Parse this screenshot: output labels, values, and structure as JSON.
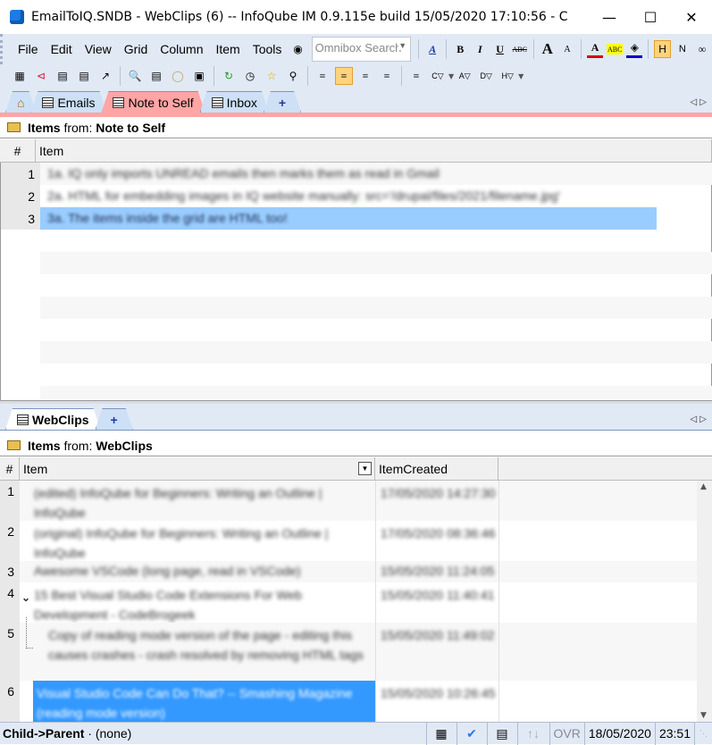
{
  "window": {
    "title": "EmailToIQ.SNDB - WebClips (6) -- InfoQube IM 0.9.115e  build 15/05/2020 17:10:56 - C..."
  },
  "menu": [
    "File",
    "Edit",
    "View",
    "Grid",
    "Column",
    "Item",
    "Tools"
  ],
  "omnibox": {
    "placeholder": "Omnibox Search"
  },
  "format_toolbar": {
    "bold": "B",
    "italic": "I",
    "underline": "U",
    "strike": "ABC",
    "grow": "A",
    "shrink": "A",
    "fontcolor": "A",
    "highlight": "ABC",
    "h": "H",
    "n": "N"
  },
  "filter_toolbar": {
    "c": "C",
    "a": "A",
    "d": "D",
    "h": "H"
  },
  "top_tabs": [
    {
      "label": ""
    },
    {
      "label": "Emails"
    },
    {
      "label": "Note to Self",
      "active": true
    },
    {
      "label": "Inbox"
    },
    {
      "label": "+"
    }
  ],
  "top_pane": {
    "items_label": "Items",
    "from_label": "from:",
    "source": "Note to Self",
    "columns": [
      "#",
      "Item"
    ],
    "rows": [
      {
        "n": "1",
        "item": "1a. IQ only imports UNREAD emails then marks them as read in Gmail"
      },
      {
        "n": "2",
        "item": "2a. HTML for embedding images in IQ website manually: src='/drupal/files/2021/filename.jpg'"
      },
      {
        "n": "3",
        "item": "3a. The items inside the grid are HTML too!",
        "selected": true
      }
    ]
  },
  "bottom_tabs": [
    {
      "label": "WebClips",
      "active": true
    },
    {
      "label": "+"
    }
  ],
  "bottom_pane": {
    "items_label": "Items",
    "from_label": "from:",
    "source": "WebClips",
    "columns": [
      "#",
      "Item",
      "ItemCreated"
    ],
    "rows": [
      {
        "n": "1",
        "item": "(edited) InfoQube for Beginners: Writing an Outline | InfoQube",
        "created": "17/05/2020 14:27:30"
      },
      {
        "n": "2",
        "item": "(original) InfoQube for Beginners: Writing an Outline | InfoQube",
        "created": "17/05/2020 08:36:46"
      },
      {
        "n": "3",
        "item": "Awesome VSCode (long page, read in VSCode)",
        "created": "15/05/2020 11:24:05"
      },
      {
        "n": "4",
        "item": "15 Best Visual Studio Code Extensions For Web Development - CodeBrogeek",
        "created": "15/05/2020 11:40:41",
        "expanded": true
      },
      {
        "n": "5",
        "item": "Copy of reading mode version of the page - editing this causes crashes - crash resolved by removing HTML tags",
        "created": "15/05/2020 11:49:02"
      },
      {
        "n": "6",
        "item": "Visual Studio Code Can Do That? -- Smashing Magazine (reading mode version)",
        "created": "15/05/2020 10:26:45",
        "selected": true
      }
    ]
  },
  "status": {
    "mode": "Child->Parent",
    "sep": "·",
    "value": "(none)",
    "ovr": "OVR",
    "date": "18/05/2020",
    "time": "23:51"
  },
  "colors": {
    "active_tab": "#ffa5a5",
    "toolbar_bg": "#e1e9f5",
    "selected_row_light": "#99ccff",
    "selected_row": "#3399ff"
  }
}
